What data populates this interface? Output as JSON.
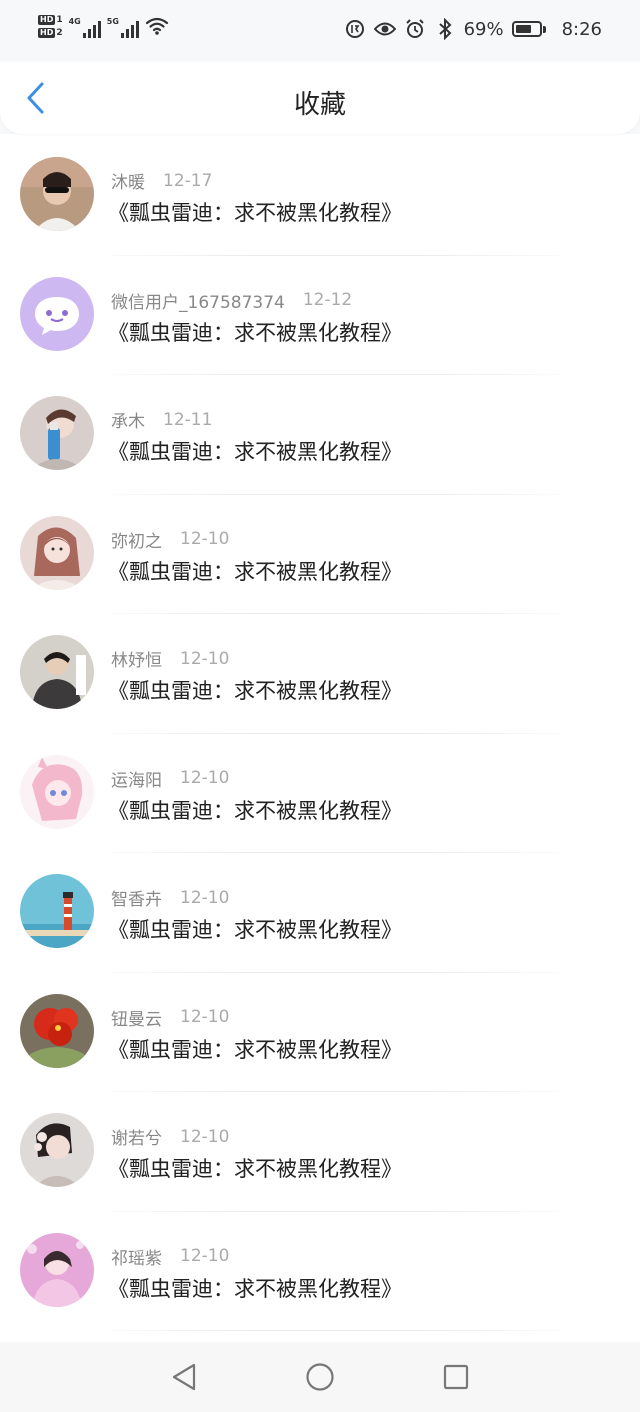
{
  "status_bar": {
    "sim1": "HD",
    "sim1_num": "1",
    "sim2": "HD",
    "sim2_num": "2",
    "net1": "4G",
    "net2": "5G",
    "battery_text": "69%",
    "battery_level": 0.69,
    "time": "8:26",
    "icons": [
      "signal-icon",
      "wifi-icon",
      "data-saver-icon",
      "eye-icon",
      "alarm-icon",
      "bluetooth-icon",
      "battery-icon"
    ]
  },
  "header": {
    "title": "收藏",
    "accent": "#3a8ee6"
  },
  "items": [
    {
      "name": "沐暖",
      "date": "12-17",
      "title": "《瓢虫雷迪：求不被黑化教程》"
    },
    {
      "name": "微信用户_167587374",
      "date": "12-12",
      "title": "《瓢虫雷迪：求不被黑化教程》"
    },
    {
      "name": "承木",
      "date": "12-11",
      "title": "《瓢虫雷迪：求不被黑化教程》"
    },
    {
      "name": "弥初之",
      "date": "12-10",
      "title": "《瓢虫雷迪：求不被黑化教程》"
    },
    {
      "name": "林妤恒",
      "date": "12-10",
      "title": "《瓢虫雷迪：求不被黑化教程》"
    },
    {
      "name": "运海阳",
      "date": "12-10",
      "title": "《瓢虫雷迪：求不被黑化教程》"
    },
    {
      "name": "智香卉",
      "date": "12-10",
      "title": "《瓢虫雷迪：求不被黑化教程》"
    },
    {
      "name": "钮曼云",
      "date": "12-10",
      "title": "《瓢虫雷迪：求不被黑化教程》"
    },
    {
      "name": "谢若兮",
      "date": "12-10",
      "title": "《瓢虫雷迪：求不被黑化教程》"
    },
    {
      "name": "祁瑶紫",
      "date": "12-10",
      "title": "《瓢虫雷迪：求不被黑化教程》"
    }
  ],
  "navbar": {
    "buttons": [
      "back-triangle-icon",
      "home-circle-icon",
      "recents-square-icon"
    ]
  }
}
